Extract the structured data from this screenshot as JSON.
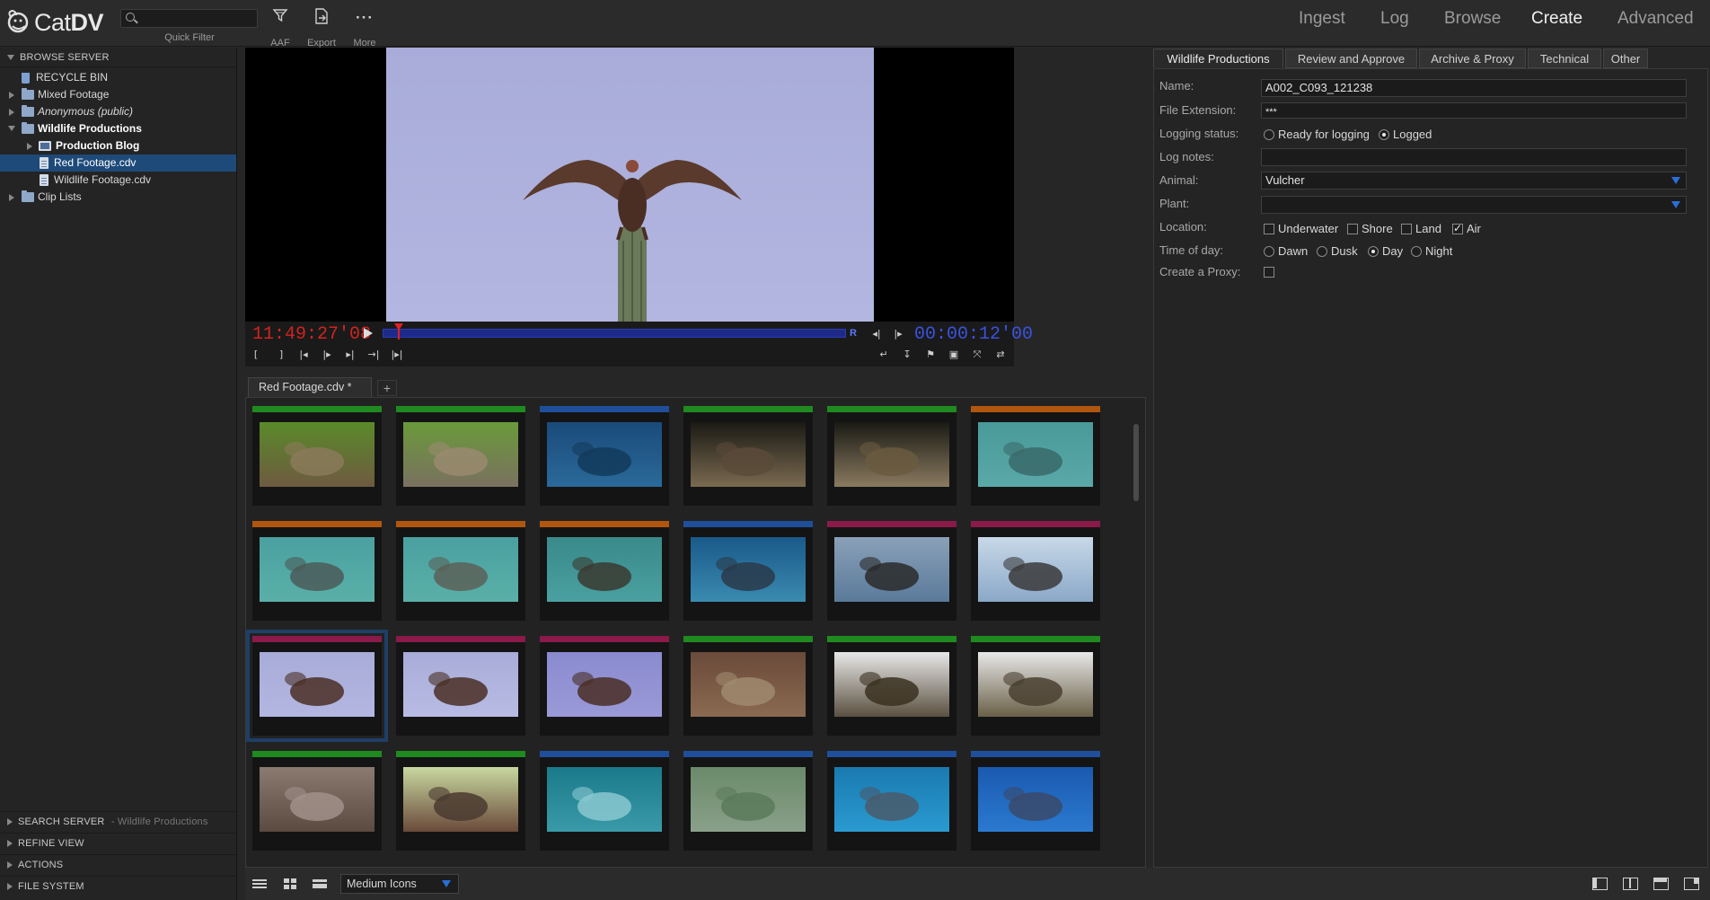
{
  "app": {
    "logo_text_light": "Cat",
    "logo_text_bold": "DV"
  },
  "toolbar": {
    "quick_filter_label": "Quick Filter",
    "search_value": "",
    "aaf_label": "AAF",
    "export_label": "Export",
    "more_label": "More"
  },
  "nav": {
    "ingest": "Ingest",
    "log": "Log",
    "browse": "Browse",
    "create": "Create",
    "advanced": "Advanced",
    "active": "Create"
  },
  "left": {
    "browse_server": "BROWSE SERVER",
    "tree": [
      {
        "label": "RECYCLE BIN",
        "icon": "trash-icon",
        "depth": 1
      },
      {
        "label": "Mixed Footage",
        "icon": "folder-icon",
        "depth": 0
      },
      {
        "label": "Anonymous (public)",
        "icon": "folder-icon",
        "depth": 0,
        "italic": true
      },
      {
        "label": "Wildlife Productions",
        "icon": "folder-icon",
        "depth": 0,
        "bold": true,
        "expanded": true
      },
      {
        "label": "Production Blog",
        "icon": "blog-icon",
        "depth": 1,
        "bold": true
      },
      {
        "label": "Red Footage.cdv",
        "icon": "document-icon",
        "depth": 2,
        "selected": true
      },
      {
        "label": "Wildlife Footage.cdv",
        "icon": "document-icon",
        "depth": 2
      },
      {
        "label": "Clip Lists",
        "icon": "folder-icon",
        "depth": 0
      }
    ],
    "search_server": "SEARCH SERVER",
    "search_server_suffix": "- Wildlife Productions",
    "refine_view": "REFINE VIEW",
    "actions": "ACTIONS",
    "file_system": "FILE SYSTEM"
  },
  "viewer": {
    "timecode_in": "11:49:27'08",
    "timecode_duration": "00:00:12'00",
    "marker_label": "R",
    "playhead_progress": 0.035
  },
  "clips": {
    "tab_label": "Red Footage.cdv *",
    "add_tab": "+",
    "view_mode": "Medium Icons",
    "colors": {
      "green": "#1f8a1f",
      "blue": "#1f4f9a",
      "orange": "#b0560f",
      "magenta": "#8a1a4a"
    },
    "rows": [
      [
        "green",
        "green",
        "blue",
        "green",
        "green",
        "orange"
      ],
      [
        "orange",
        "orange",
        "orange",
        "blue",
        "magenta",
        "magenta"
      ],
      [
        "magenta",
        "magenta",
        "magenta",
        "green",
        "green",
        "green"
      ],
      [
        "green",
        "green",
        "blue",
        "blue",
        "blue",
        "blue"
      ]
    ],
    "thumbs": [
      [
        "tortoise-shell",
        "tortoise-grass",
        "seal-underwater",
        "tortoise-face",
        "tortoise-face-2",
        "seal-water"
      ],
      [
        "sea-lion-1",
        "sea-lion-2",
        "sea-lion-3",
        "dolphin",
        "pelicans",
        "bird-flying"
      ],
      [
        "vulture-cactus",
        "vulture-2",
        "vulture-3",
        "iguana-cactus",
        "iguana-face",
        "iguana-face-2"
      ],
      [
        "iguana-claw",
        "iguana-spikes",
        "fish-school",
        "murky-water",
        "shark",
        "diver"
      ]
    ],
    "selected_index": 12
  },
  "metadata": {
    "tabs": [
      "Wildlife Productions",
      "Review and Approve",
      "Archive & Proxy",
      "Technical",
      "Other"
    ],
    "active_tab": "Wildlife Productions",
    "name_label": "Name:",
    "name_value": "A002_C093_121238",
    "ext_label": "File Extension:",
    "ext_value": "***",
    "logging_label": "Logging status:",
    "logging_opts": [
      "Ready for logging",
      "Logged"
    ],
    "logging_value": "Logged",
    "notes_label": "Log notes:",
    "notes_value": "",
    "animal_label": "Animal:",
    "animal_value": "Vulcher",
    "plant_label": "Plant:",
    "plant_value": "",
    "location_label": "Location:",
    "location_opts": [
      "Underwater",
      "Shore",
      "Land",
      "Air"
    ],
    "location_checked": [
      "Air"
    ],
    "time_label": "Time of day:",
    "time_opts": [
      "Dawn",
      "Dusk",
      "Day",
      "Night"
    ],
    "time_value": "Day",
    "proxy_label": "Create a Proxy:",
    "proxy_checked": false
  }
}
